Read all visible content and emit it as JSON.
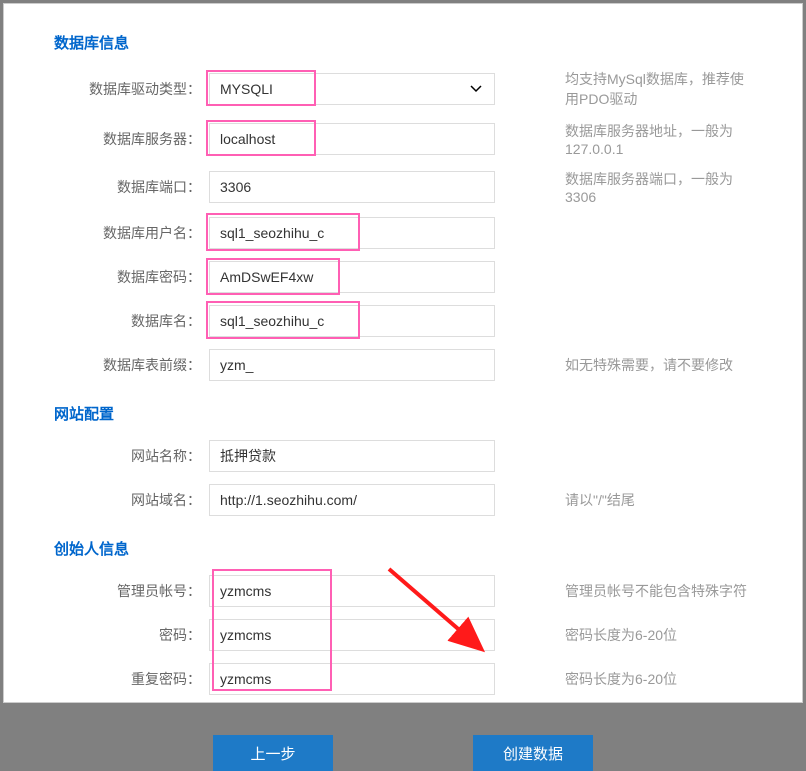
{
  "section_db": {
    "title": "数据库信息",
    "driver": {
      "label": "数据库驱动类型：",
      "value": "MYSQLI",
      "hint": "均支持MySql数据库，推荐使用PDO驱动"
    },
    "server": {
      "label": "数据库服务器：",
      "value": "localhost",
      "hint": "数据库服务器地址，一般为127.0.0.1"
    },
    "port": {
      "label": "数据库端口：",
      "value": "3306",
      "hint": "数据库服务器端口，一般为3306"
    },
    "username": {
      "label": "数据库用户名：",
      "value": "sql1_seozhihu_c"
    },
    "password": {
      "label": "数据库密码：",
      "value": "AmDSwEF4xw"
    },
    "dbname": {
      "label": "数据库名：",
      "value": "sql1_seozhihu_c"
    },
    "prefix": {
      "label": "数据库表前缀：",
      "value": "yzm_",
      "hint": "如无特殊需要，请不要修改"
    }
  },
  "section_site": {
    "title": "网站配置",
    "sitename": {
      "label": "网站名称：",
      "value": "抵押贷款"
    },
    "domain": {
      "label": "网站域名：",
      "value": "http://1.seozhihu.com/",
      "hint": "请以\"/\"结尾"
    }
  },
  "section_founder": {
    "title": "创始人信息",
    "admin": {
      "label": "管理员帐号：",
      "value": "yzmcms",
      "hint": "管理员帐号不能包含特殊字符"
    },
    "pwd": {
      "label": "密码：",
      "value": "yzmcms",
      "hint": "密码长度为6-20位"
    },
    "pwd2": {
      "label": "重复密码：",
      "value": "yzmcms",
      "hint": "密码长度为6-20位"
    }
  },
  "buttons": {
    "prev": "上一步",
    "create": "创建数据"
  }
}
